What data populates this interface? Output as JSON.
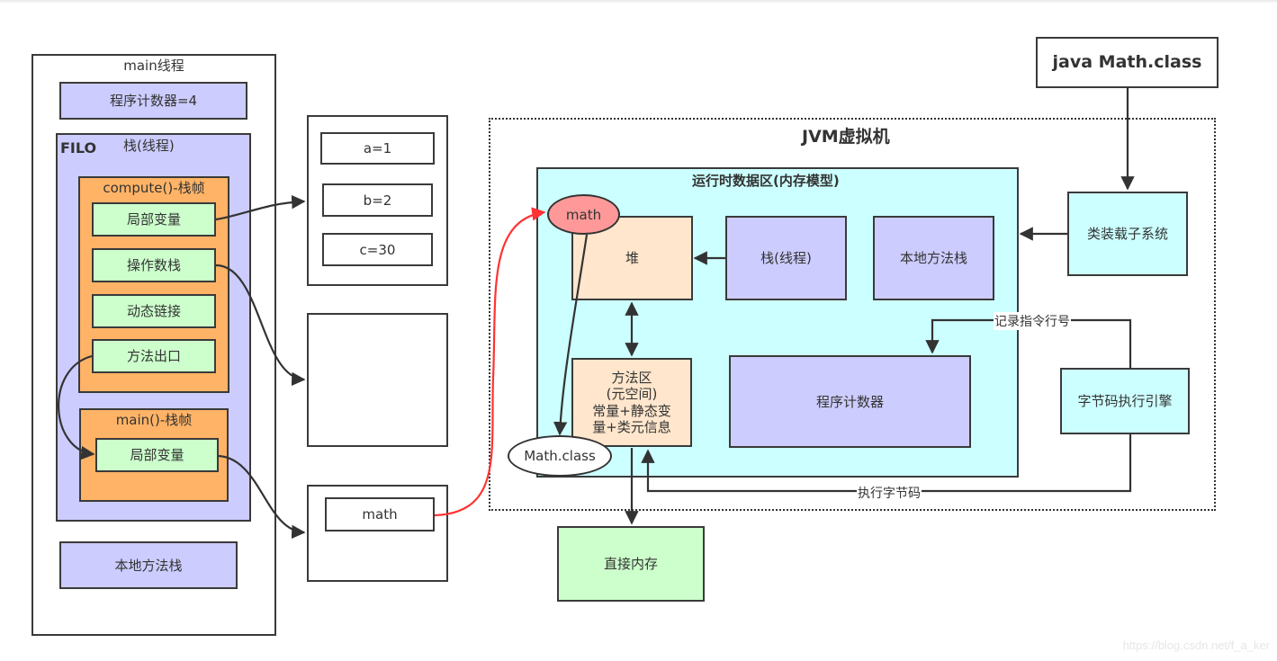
{
  "main_thread": {
    "title": "main线程",
    "program_counter": "程序计数器=4",
    "stack": {
      "order_label": "FILO",
      "title": "栈(线程)",
      "frames": [
        {
          "title": "compute()-栈帧",
          "items": [
            "局部变量",
            "操作数栈",
            "动态链接",
            "方法出口"
          ]
        },
        {
          "title": "main()-栈帧",
          "items": [
            "局部变量"
          ]
        }
      ]
    },
    "native_stack": "本地方法栈"
  },
  "local_vars_box": {
    "items": [
      "a=1",
      "b=2",
      "c=30"
    ]
  },
  "operand_box": {
    "items": []
  },
  "main_locals_box": {
    "items": [
      "math"
    ]
  },
  "jvm": {
    "title": "JVM虚拟机",
    "runtime_area": {
      "title": "运行时数据区(内存模型)",
      "heap": "堆",
      "heap_object": "math",
      "stack": "栈(线程)",
      "native_stack": "本地方法栈",
      "method_area": "方法区\n(元空间)\n常量+静态变\n量+类元信息",
      "method_area_lines": [
        "方法区",
        "(元空间)",
        "常量+静态变",
        "量+类元信息"
      ],
      "class_object": "Math.class",
      "program_counter": "程序计数器"
    },
    "class_loader": "类装载子系统",
    "exec_engine": "字节码执行引擎",
    "edge_labels": {
      "record_line": "记录指令行号",
      "exec_bytecode": "执行字节码"
    }
  },
  "source": "java Math.class",
  "direct_memory": "直接内存",
  "watermark": "https://blog.csdn.net/f_a_ker",
  "colors": {
    "lavender": "#ccccff",
    "orange": "#ffb366",
    "green": "#ccffcc",
    "cyan": "#ccffff",
    "peach": "#ffe6cc",
    "ref_ellipse": "#ff9999",
    "ref_arrow": "#ff3333",
    "line": "#333333"
  }
}
